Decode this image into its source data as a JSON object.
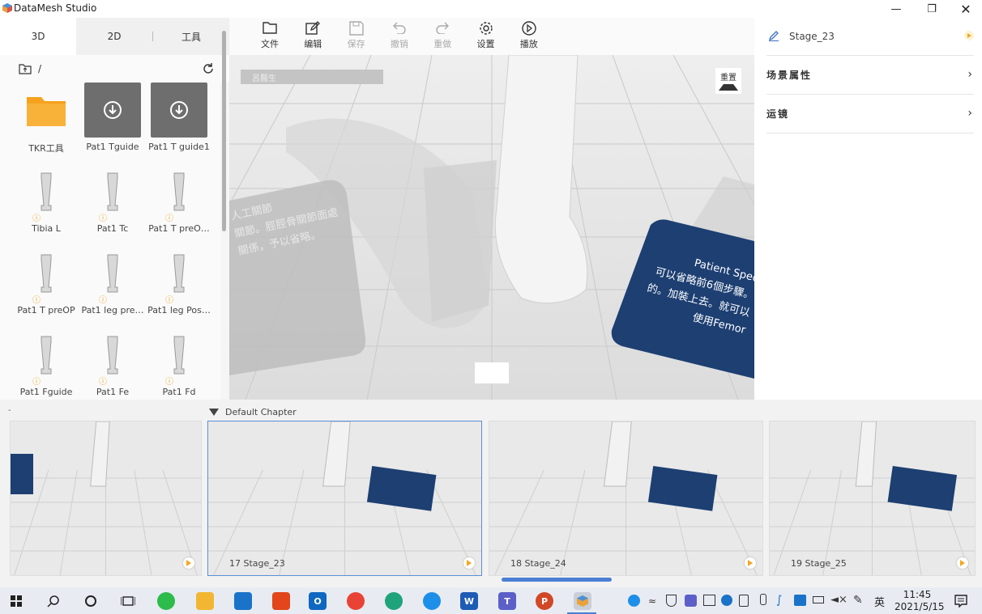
{
  "app": {
    "title": "DataMesh Studio"
  },
  "left": {
    "tabs": [
      "3D",
      "2D",
      "工具"
    ],
    "path": "/",
    "assets": [
      {
        "label": "TKR工具",
        "type": "folder",
        "warn": false
      },
      {
        "label": "Pat1 Tguide",
        "type": "download",
        "warn": false
      },
      {
        "label": "Pat1 T guide1",
        "type": "download",
        "warn": false
      },
      {
        "label": "Tibia L",
        "type": "model",
        "warn": true
      },
      {
        "label": "Pat1 Tc",
        "type": "model",
        "warn": true
      },
      {
        "label": "Pat1 T preO…",
        "type": "model",
        "warn": true
      },
      {
        "label": "Pat1 T preOP",
        "type": "model",
        "warn": true
      },
      {
        "label": "Pat1 leg pre…",
        "type": "model",
        "warn": true
      },
      {
        "label": "Pat1 leg Pos…",
        "type": "model",
        "warn": true
      },
      {
        "label": "Pat1 Fguide",
        "type": "model",
        "warn": true
      },
      {
        "label": "Pat1 Fe",
        "type": "model",
        "warn": true
      },
      {
        "label": "Pat1 Fd",
        "type": "model",
        "warn": true
      }
    ]
  },
  "toolbar": {
    "items": [
      {
        "label": "文件",
        "icon": "folder-icon",
        "enabled": true
      },
      {
        "label": "编辑",
        "icon": "edit-icon",
        "enabled": true
      },
      {
        "label": "保存",
        "icon": "save-icon",
        "enabled": false
      },
      {
        "label": "撤销",
        "icon": "undo-icon",
        "enabled": false
      },
      {
        "label": "重做",
        "icon": "redo-icon",
        "enabled": false
      },
      {
        "label": "设置",
        "icon": "gear-icon",
        "enabled": true
      },
      {
        "label": "播放",
        "icon": "play-icon",
        "enabled": true
      }
    ]
  },
  "viewport": {
    "name_bar": "呂醫生",
    "reset_label": "重置",
    "left_card_text": [
      "人工關節",
      "關節。脛脛骨關節面處",
      "關係，予以省略。"
    ],
    "right_card_text": [
      "Patient Spec",
      "可以省略前6個步驟。",
      "的。加裝上去。就可以",
      "使用Femor"
    ]
  },
  "right": {
    "stage": "Stage_23",
    "rows": [
      "场景属性",
      "运镜"
    ]
  },
  "timeline": {
    "chapter": "Default Chapter",
    "cards": [
      {
        "label": ""
      },
      {
        "label": "17  Stage_23",
        "selected": true
      },
      {
        "label": "18  Stage_24"
      },
      {
        "label": "19  Stage_25"
      }
    ]
  },
  "taskbar": {
    "ime": "英",
    "time": "11:45",
    "date": "2021/5/15"
  },
  "colors": {
    "accent": "#4a7fd4",
    "card_navy": "#1d3f72",
    "warn": "#e8a317",
    "play": "#f5a623"
  }
}
